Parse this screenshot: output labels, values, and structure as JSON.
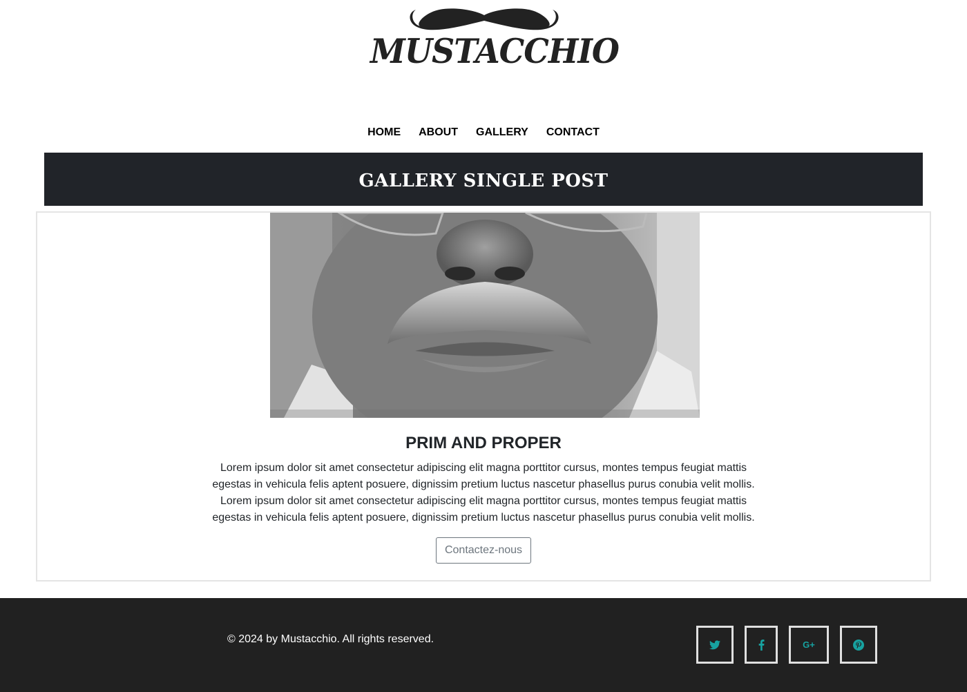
{
  "brand": {
    "name": "MUSTACCHIO"
  },
  "nav": {
    "items": [
      {
        "label": "HOME"
      },
      {
        "label": "ABOUT"
      },
      {
        "label": "GALLERY"
      },
      {
        "label": "CONTACT"
      }
    ]
  },
  "banner": {
    "title": "GALLERY SINGLE POST"
  },
  "post": {
    "title": "PRIM AND PROPER",
    "body": "Lorem ipsum dolor sit amet consectetur adipiscing elit magna porttitor cursus, montes tempus feugiat mattis egestas in vehicula felis aptent posuere, dignissim pretium luctus nascetur phasellus purus conubia velit mollis. Lorem ipsum dolor sit amet consectetur adipiscing elit magna porttitor cursus, montes tempus feugiat mattis egestas in vehicula felis aptent posuere, dignissim pretium luctus nascetur phasellus purus conubia velit mollis.",
    "cta_label": "Contactez-nous",
    "image": "mustache-portrait-photo"
  },
  "footer": {
    "copyright": "© 2024 by Mustacchio. All rights reserved.",
    "social": [
      {
        "icon": "twitter-icon"
      },
      {
        "icon": "facebook-icon"
      },
      {
        "icon": "google-plus-icon",
        "label": "G+"
      },
      {
        "icon": "pinterest-icon"
      }
    ]
  },
  "colors": {
    "banner_bg": "#212429",
    "footer_bg": "#212121",
    "social_accent": "#17a2a0",
    "button_border": "#6c757d"
  }
}
